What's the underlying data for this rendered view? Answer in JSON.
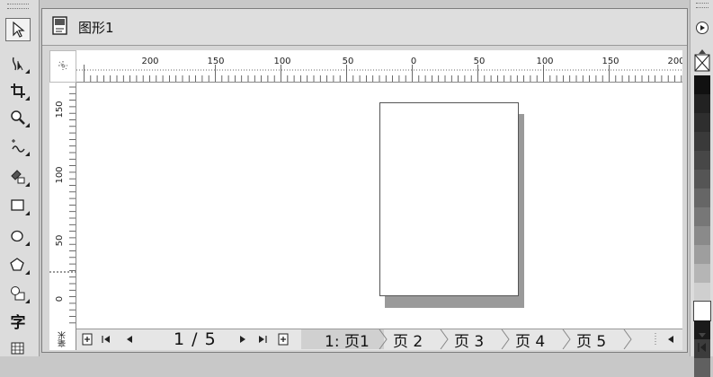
{
  "document": {
    "title": "图形1"
  },
  "toolbox": {
    "text_tool_glyph": "字",
    "tools": [
      {
        "name": "pick-tool",
        "icon": "arrow-pointer-icon"
      },
      {
        "name": "shape-tool",
        "icon": "shape-edit-icon"
      },
      {
        "name": "crop-tool",
        "icon": "crop-icon"
      },
      {
        "name": "zoom-tool",
        "icon": "magnifier-icon"
      },
      {
        "name": "freehand-tool",
        "icon": "freehand-curve-icon"
      },
      {
        "name": "smart-fill-tool",
        "icon": "smart-fill-icon"
      },
      {
        "name": "rectangle-tool",
        "icon": "rectangle-icon"
      },
      {
        "name": "ellipse-tool",
        "icon": "ellipse-icon"
      },
      {
        "name": "polygon-tool",
        "icon": "polygon-icon"
      },
      {
        "name": "basic-shapes-tool",
        "icon": "basic-shapes-icon"
      },
      {
        "name": "text-tool",
        "icon": "text-icon"
      },
      {
        "name": "table-tool",
        "icon": "table-icon"
      }
    ]
  },
  "rulers": {
    "horizontal_labels": [
      "200",
      "150",
      "100",
      "50",
      "0",
      "50",
      "100",
      "150",
      "200"
    ],
    "vertical_labels": [
      "150",
      "100",
      "50",
      "0"
    ],
    "unit_label": "毫米"
  },
  "navigation": {
    "page_counter": "1 / 5",
    "tabs": [
      "1: 页1",
      "页 2",
      "页 3",
      "页 4",
      "页 5"
    ]
  },
  "palette": {
    "colors": [
      "#111111",
      "#222222",
      "#2e2e2e",
      "#3a3a3a",
      "#474747",
      "#555555",
      "#666666",
      "#777777",
      "#8a8a8a",
      "#9e9e9e",
      "#b5b5b5",
      "#cfcfcf",
      "#ffffff",
      "#1a1a1a",
      "#3c3c3c",
      "#606060"
    ]
  }
}
